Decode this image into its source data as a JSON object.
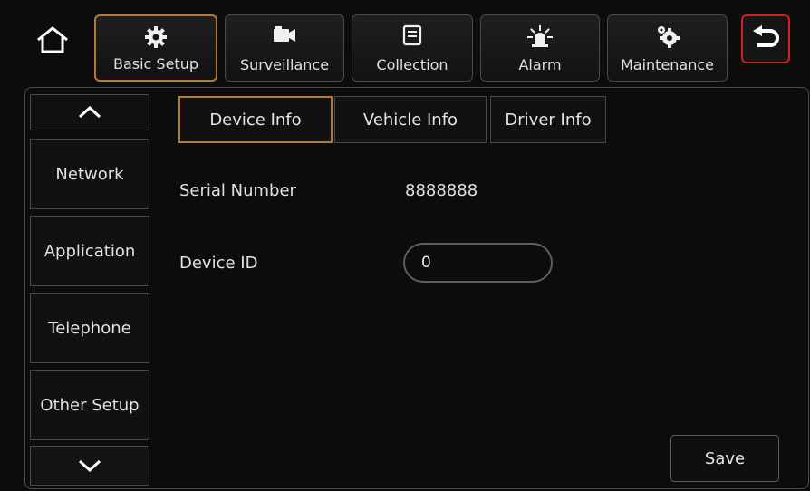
{
  "topbar": {
    "tabs": [
      {
        "label": "Basic Setup",
        "icon": "gear-icon"
      },
      {
        "label": "Surveillance",
        "icon": "camera-icon"
      },
      {
        "label": "Collection",
        "icon": "document-icon"
      },
      {
        "label": "Alarm",
        "icon": "alarm-light-icon"
      },
      {
        "label": "Maintenance",
        "icon": "gears-icon"
      }
    ],
    "home_icon": "home-icon",
    "back_icon": "back-arrow-icon"
  },
  "sidebar": {
    "items": [
      {
        "label": "Network"
      },
      {
        "label": "Application"
      },
      {
        "label": "Telephone"
      },
      {
        "label": "Other Setup"
      }
    ]
  },
  "subtabs": [
    {
      "label": "Device Info"
    },
    {
      "label": "Vehicle Info"
    },
    {
      "label": "Driver Info"
    }
  ],
  "device_info": {
    "serial_label": "Serial Number",
    "serial_value": "8888888",
    "device_id_label": "Device ID",
    "device_id_value": "0"
  },
  "save_label": "Save",
  "colors": {
    "background": "#0c0c0c",
    "active_border": "#b5783b",
    "back_border": "#d21f1f",
    "border": "#4a4a4a"
  }
}
